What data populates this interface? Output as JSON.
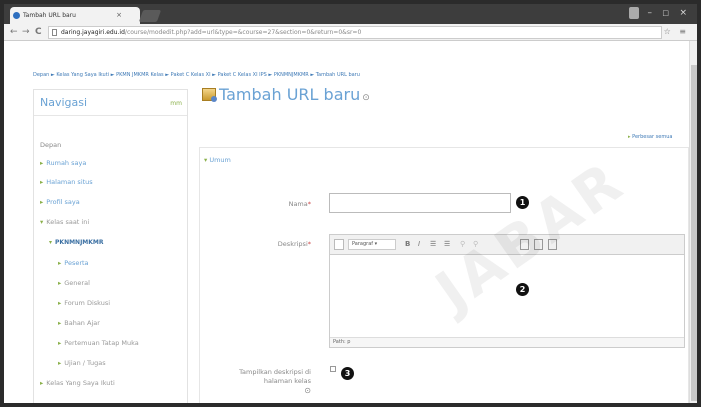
{
  "browser": {
    "tab_title": "Tambah URL baru",
    "tab_close": "×",
    "controls": {
      "minimize": "–",
      "maximize": "□",
      "close": "×"
    },
    "url_host": "daring.jayagiri.edu.id",
    "url_path": "/course/modedit.php?add=url&type=&course=27&section=0&return=0&sr=0",
    "nav": {
      "back": "←",
      "forward": "→",
      "reload": "C"
    },
    "toolbar_icons": "☆ ≡"
  },
  "breadcrumb": "Depan ► Kelas Yang Saya Ikuti ► PKMN JMKMR Kelas ► Paket C Kelas XI ► Paket C Kelas XI IPS ► PKNMNJMKMR ► Tambah URL baru",
  "sidebar": {
    "title": "Navigasi",
    "toggle": "mm",
    "items": [
      {
        "label": "Depan",
        "arrow": ""
      },
      {
        "label": "Rumah saya",
        "arrow": "▸"
      },
      {
        "label": "Halaman situs",
        "arrow": "▸"
      },
      {
        "label": "Profil saya",
        "arrow": "▸"
      },
      {
        "label": "Kelas saat ini",
        "arrow": "▾"
      },
      {
        "label": "PKNMNJMKMR",
        "arrow": "▾"
      },
      {
        "label": "Peserta",
        "arrow": "▸"
      },
      {
        "label": "General",
        "arrow": "▸"
      },
      {
        "label": "Forum Diskusi",
        "arrow": "▸"
      },
      {
        "label": "Bahan Ajar",
        "arrow": "▸"
      },
      {
        "label": "Pertemuan Tatap Muka",
        "arrow": "▸"
      },
      {
        "label": "Ujian / Tugas",
        "arrow": "▸"
      },
      {
        "label": "Kelas Yang Saya Ikuti",
        "arrow": "▸"
      }
    ]
  },
  "main": {
    "title": "Tambah URL baru",
    "help": "⊙",
    "expand_all": "Perbesar semua",
    "section": "Umum",
    "fields": {
      "name_label": "Nama",
      "desc_label": "Deskripsi",
      "show_desc_label": "Tampilkan deskripsi di halaman kelas",
      "required": "*",
      "help": "⊙"
    },
    "editor": {
      "paragraph": "Paragraf",
      "bold": "B",
      "italic": "I",
      "path": "Path: p"
    },
    "badges": [
      "1",
      "2",
      "3"
    ]
  },
  "watermark": "JABAR"
}
